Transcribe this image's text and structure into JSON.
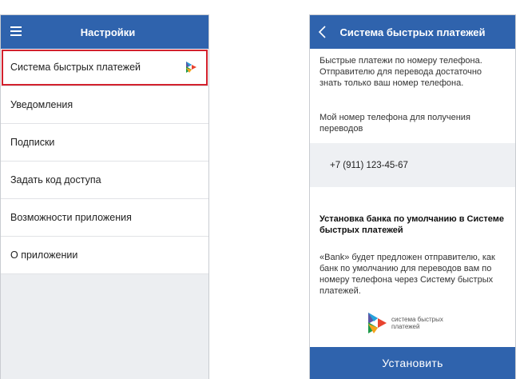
{
  "left_screen": {
    "header": {
      "title": "Настройки",
      "menu_icon": "hamburger-menu-icon"
    },
    "menu_items": [
      {
        "label": "Система быстрых платежей",
        "highlighted": true,
        "icon": "sbp-logo-icon"
      },
      {
        "label": "Уведомления"
      },
      {
        "label": "Подписки"
      },
      {
        "label": "Задать код доступа"
      },
      {
        "label": "Возможности приложения"
      },
      {
        "label": "О приложении"
      }
    ],
    "highlight_color": "#d3212d"
  },
  "right_screen": {
    "header": {
      "title": "Система быстрых платежей",
      "back_icon": "chevron-left-icon"
    },
    "intro_text": "Быстрые платежи по номеру телефона. Отправителю для перевода достаточно знать только ваш номер телефона.",
    "phone_label": "Мой номер телефона для получения переводов",
    "phone_value": "+7 (911) 123-45-67",
    "default_bank_title": "Установка банка по умолчанию в Системе быстрых платежей",
    "default_bank_text": "«Bank» будет предложен отправителю, как банк по умолчанию для переводов вам по номеру телефона через Систему быстрых платежей.",
    "logo_text": "система быстрых платежей",
    "install_button": "Установить"
  },
  "colors": {
    "header_blue": "#2f63ad",
    "button_blue": "#2f63ad",
    "filler_gray": "#eceef1"
  }
}
